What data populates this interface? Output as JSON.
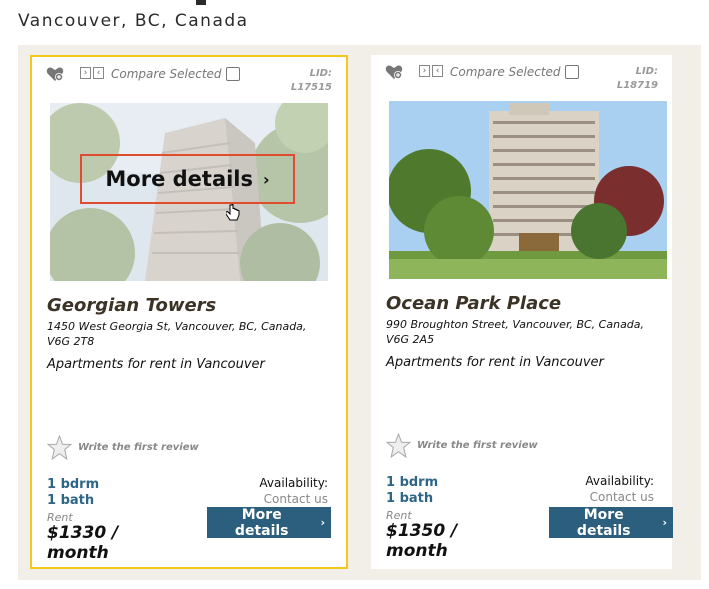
{
  "page": {
    "title": "Vancouver, BC, Canada"
  },
  "listings": [
    {
      "compare_label": "Compare Selected",
      "lid_label": "LID:",
      "lid": "L17515",
      "overlay_button": "More details",
      "name": "Georgian Towers",
      "address": "1450 West Georgia St, Vancouver, BC, Canada, V6G 2T8",
      "description": "Apartments for rent in Vancouver",
      "review_prompt": "Write the first review",
      "beds": "1 bdrm",
      "baths": "1 bath",
      "rent_label": "Rent",
      "price": "$1330 / month",
      "availability_label": "Availability:",
      "availability_value": "Contact us",
      "button_label": "More details"
    },
    {
      "compare_label": "Compare Selected",
      "lid_label": "LID:",
      "lid": "L18719",
      "name": "Ocean Park Place",
      "address": "990 Broughton Street, Vancouver, BC, Canada, V6G 2A5",
      "description": "Apartments for rent in Vancouver",
      "review_prompt": "Write the first review",
      "beds": "1 bdrm",
      "baths": "1 bath",
      "rent_label": "Rent",
      "price": "$1350 / month",
      "availability_label": "Availability:",
      "availability_value": "Contact us",
      "button_label": "More details"
    }
  ],
  "icons": [
    "heart-add-icon",
    "compare-icon",
    "checkbox-icon",
    "star-icon",
    "chevron-right-icon",
    "hand-cursor-icon"
  ],
  "colors": {
    "selected_border": "#f2c81b",
    "button_bg": "#2b5f7d",
    "beds_text": "#2e6688",
    "highlight_box": "#e04c2f"
  }
}
